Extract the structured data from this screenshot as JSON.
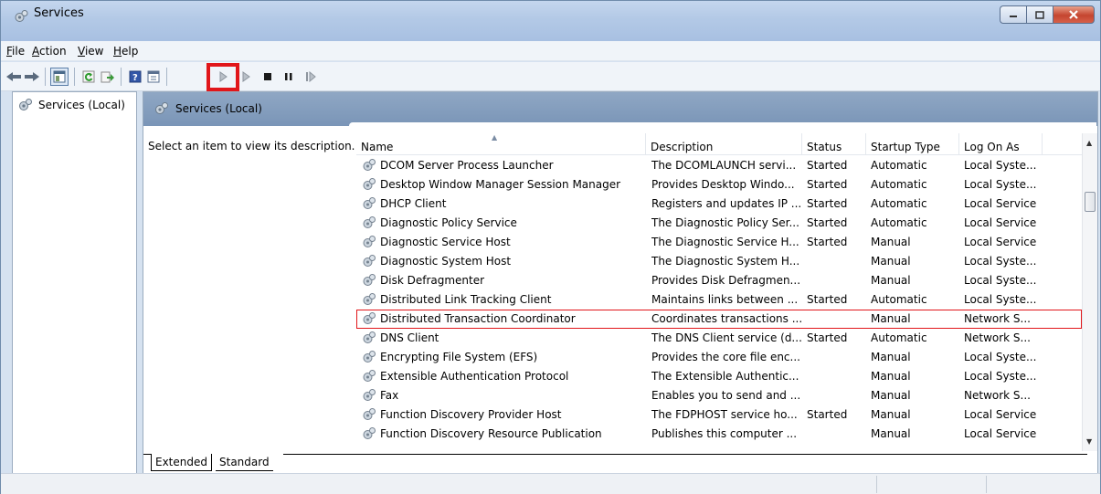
{
  "window": {
    "title": "Services"
  },
  "menu": [
    {
      "acc": "F",
      "rest": "ile"
    },
    {
      "acc": "A",
      "rest": "ction"
    },
    {
      "acc": "V",
      "rest": "iew"
    },
    {
      "acc": "H",
      "rest": "elp"
    }
  ],
  "toolbar": {
    "icons": [
      "back-icon",
      "forward-icon",
      "show-hide-tree-icon",
      "refresh-icon",
      "export-list-icon",
      "help-icon",
      "properties-icon",
      "start-service-icon",
      "start-service-alt-icon",
      "stop-service-icon",
      "pause-service-icon",
      "resume-service-icon"
    ]
  },
  "tree": {
    "root_label": "Services (Local)"
  },
  "pane": {
    "header_title": "Services (Local)",
    "description_prompt": "Select an item to view its description."
  },
  "columns": [
    "Name",
    "Description",
    "Status",
    "Startup Type",
    "Log On As"
  ],
  "services": [
    {
      "name": "DCOM Server Process Launcher",
      "description": "The DCOMLAUNCH servi...",
      "status": "Started",
      "startup": "Automatic",
      "logon": "Local Syste..."
    },
    {
      "name": "Desktop Window Manager Session Manager",
      "description": "Provides Desktop Windo...",
      "status": "Started",
      "startup": "Automatic",
      "logon": "Local Syste..."
    },
    {
      "name": "DHCP Client",
      "description": "Registers and updates IP ...",
      "status": "Started",
      "startup": "Automatic",
      "logon": "Local Service"
    },
    {
      "name": "Diagnostic Policy Service",
      "description": "The Diagnostic Policy Ser...",
      "status": "Started",
      "startup": "Automatic",
      "logon": "Local Service"
    },
    {
      "name": "Diagnostic Service Host",
      "description": "The Diagnostic Service H...",
      "status": "Started",
      "startup": "Manual",
      "logon": "Local Service"
    },
    {
      "name": "Diagnostic System Host",
      "description": "The Diagnostic System H...",
      "status": "",
      "startup": "Manual",
      "logon": "Local Syste..."
    },
    {
      "name": "Disk Defragmenter",
      "description": "Provides Disk Defragmen...",
      "status": "",
      "startup": "Manual",
      "logon": "Local Syste..."
    },
    {
      "name": "Distributed Link Tracking Client",
      "description": "Maintains links between ...",
      "status": "Started",
      "startup": "Automatic",
      "logon": "Local Syste..."
    },
    {
      "name": "Distributed Transaction Coordinator",
      "description": "Coordinates transactions ...",
      "status": "",
      "startup": "Manual",
      "logon": "Network S...",
      "selected": true
    },
    {
      "name": "DNS Client",
      "description": "The DNS Client service (d...",
      "status": "Started",
      "startup": "Automatic",
      "logon": "Network S..."
    },
    {
      "name": "Encrypting File System (EFS)",
      "description": "Provides the core file enc...",
      "status": "",
      "startup": "Manual",
      "logon": "Local Syste..."
    },
    {
      "name": "Extensible Authentication Protocol",
      "description": "The Extensible Authentic...",
      "status": "",
      "startup": "Manual",
      "logon": "Local Syste..."
    },
    {
      "name": "Fax",
      "description": "Enables you to send and ...",
      "status": "",
      "startup": "Manual",
      "logon": "Network S..."
    },
    {
      "name": "Function Discovery Provider Host",
      "description": "The FDPHOST service ho...",
      "status": "Started",
      "startup": "Manual",
      "logon": "Local Service"
    },
    {
      "name": "Function Discovery Resource Publication",
      "description": "Publishes this computer ...",
      "status": "",
      "startup": "Manual",
      "logon": "Local Service"
    }
  ],
  "tabs": {
    "extended": "Extended",
    "standard": "Standard",
    "active": "Extended"
  },
  "colors": {
    "highlight": "#e1161a",
    "pane_header": "#7f99ba"
  }
}
